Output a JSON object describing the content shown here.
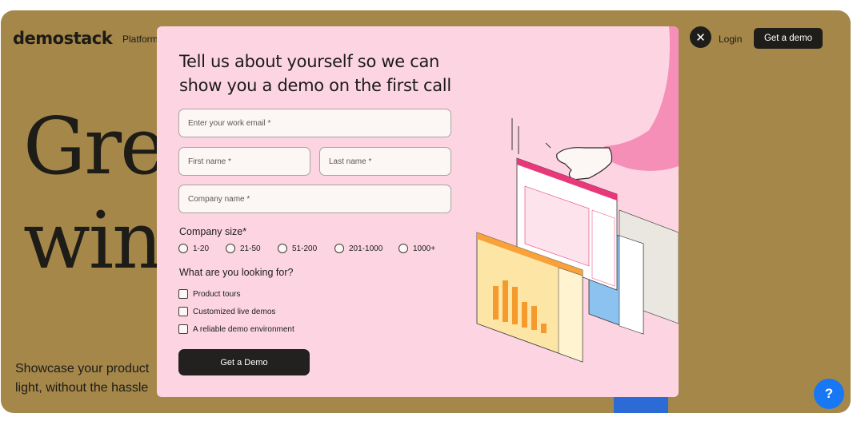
{
  "header": {
    "logo": "demostack",
    "nav_platform": "Platform",
    "login": "Login",
    "cta": "Get a demo"
  },
  "hero": {
    "line1": "Gre",
    "line2": "win",
    "subtitle_line1": "Showcase your product",
    "subtitle_line2": "light, without the hassle"
  },
  "modal": {
    "title": "Tell us about yourself so we can show you a demo on the first call",
    "email_placeholder": "Enter your work email *",
    "first_name_placeholder": "First name *",
    "last_name_placeholder": "Last name *",
    "company_placeholder": "Company name *",
    "company_size_label": "Company size*",
    "company_sizes": [
      "1-20",
      "21-50",
      "51-200",
      "201-1000",
      "1000+"
    ],
    "looking_for_label": "What are you looking for?",
    "looking_for_options": [
      "Product tours",
      "Customized live demos",
      "A reliable demo environment"
    ],
    "submit": "Get a Demo"
  },
  "help_button": "?",
  "colors": {
    "page_bg": "#a5874a",
    "modal_bg": "#fdd5e2",
    "button_dark": "#1f1d1a",
    "help_blue": "#1877f2"
  },
  "icons": {
    "close": "close-icon",
    "help": "help-icon"
  }
}
